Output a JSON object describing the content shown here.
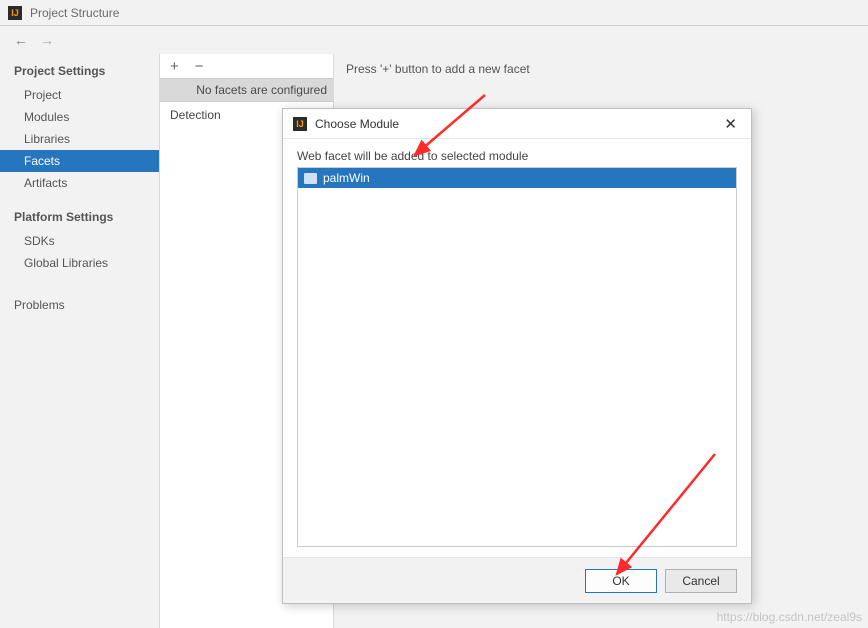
{
  "window": {
    "title": "Project Structure"
  },
  "sidebar": {
    "section1": "Project Settings",
    "items1": [
      "Project",
      "Modules",
      "Libraries",
      "Facets",
      "Artifacts"
    ],
    "active1_index": 3,
    "section2": "Platform Settings",
    "items2": [
      "SDKs",
      "Global Libraries"
    ],
    "section3_item": "Problems"
  },
  "middle": {
    "no_facets": "No facets are configured",
    "detection": "Detection"
  },
  "main": {
    "hint": "Press '+' button to add a new facet"
  },
  "modal": {
    "title": "Choose Module",
    "hint": "Web facet will be added to selected module",
    "items": [
      "palmWin"
    ],
    "selected_index": 0,
    "ok_label": "OK",
    "cancel_label": "Cancel"
  },
  "watermark": "https://blog.csdn.net/zeal9s"
}
